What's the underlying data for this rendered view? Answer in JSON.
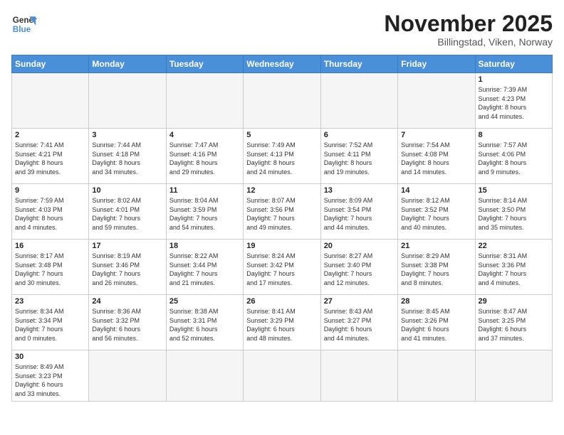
{
  "logo": {
    "line1": "General",
    "line2": "Blue"
  },
  "title": "November 2025",
  "location": "Billingstad, Viken, Norway",
  "weekdays": [
    "Sunday",
    "Monday",
    "Tuesday",
    "Wednesday",
    "Thursday",
    "Friday",
    "Saturday"
  ],
  "weeks": [
    [
      {
        "day": "",
        "info": ""
      },
      {
        "day": "",
        "info": ""
      },
      {
        "day": "",
        "info": ""
      },
      {
        "day": "",
        "info": ""
      },
      {
        "day": "",
        "info": ""
      },
      {
        "day": "",
        "info": ""
      },
      {
        "day": "1",
        "info": "Sunrise: 7:39 AM\nSunset: 4:23 PM\nDaylight: 8 hours\nand 44 minutes."
      }
    ],
    [
      {
        "day": "2",
        "info": "Sunrise: 7:41 AM\nSunset: 4:21 PM\nDaylight: 8 hours\nand 39 minutes."
      },
      {
        "day": "3",
        "info": "Sunrise: 7:44 AM\nSunset: 4:18 PM\nDaylight: 8 hours\nand 34 minutes."
      },
      {
        "day": "4",
        "info": "Sunrise: 7:47 AM\nSunset: 4:16 PM\nDaylight: 8 hours\nand 29 minutes."
      },
      {
        "day": "5",
        "info": "Sunrise: 7:49 AM\nSunset: 4:13 PM\nDaylight: 8 hours\nand 24 minutes."
      },
      {
        "day": "6",
        "info": "Sunrise: 7:52 AM\nSunset: 4:11 PM\nDaylight: 8 hours\nand 19 minutes."
      },
      {
        "day": "7",
        "info": "Sunrise: 7:54 AM\nSunset: 4:08 PM\nDaylight: 8 hours\nand 14 minutes."
      },
      {
        "day": "8",
        "info": "Sunrise: 7:57 AM\nSunset: 4:06 PM\nDaylight: 8 hours\nand 9 minutes."
      }
    ],
    [
      {
        "day": "9",
        "info": "Sunrise: 7:59 AM\nSunset: 4:03 PM\nDaylight: 8 hours\nand 4 minutes."
      },
      {
        "day": "10",
        "info": "Sunrise: 8:02 AM\nSunset: 4:01 PM\nDaylight: 7 hours\nand 59 minutes."
      },
      {
        "day": "11",
        "info": "Sunrise: 8:04 AM\nSunset: 3:59 PM\nDaylight: 7 hours\nand 54 minutes."
      },
      {
        "day": "12",
        "info": "Sunrise: 8:07 AM\nSunset: 3:56 PM\nDaylight: 7 hours\nand 49 minutes."
      },
      {
        "day": "13",
        "info": "Sunrise: 8:09 AM\nSunset: 3:54 PM\nDaylight: 7 hours\nand 44 minutes."
      },
      {
        "day": "14",
        "info": "Sunrise: 8:12 AM\nSunset: 3:52 PM\nDaylight: 7 hours\nand 40 minutes."
      },
      {
        "day": "15",
        "info": "Sunrise: 8:14 AM\nSunset: 3:50 PM\nDaylight: 7 hours\nand 35 minutes."
      }
    ],
    [
      {
        "day": "16",
        "info": "Sunrise: 8:17 AM\nSunset: 3:48 PM\nDaylight: 7 hours\nand 30 minutes."
      },
      {
        "day": "17",
        "info": "Sunrise: 8:19 AM\nSunset: 3:46 PM\nDaylight: 7 hours\nand 26 minutes."
      },
      {
        "day": "18",
        "info": "Sunrise: 8:22 AM\nSunset: 3:44 PM\nDaylight: 7 hours\nand 21 minutes."
      },
      {
        "day": "19",
        "info": "Sunrise: 8:24 AM\nSunset: 3:42 PM\nDaylight: 7 hours\nand 17 minutes."
      },
      {
        "day": "20",
        "info": "Sunrise: 8:27 AM\nSunset: 3:40 PM\nDaylight: 7 hours\nand 12 minutes."
      },
      {
        "day": "21",
        "info": "Sunrise: 8:29 AM\nSunset: 3:38 PM\nDaylight: 7 hours\nand 8 minutes."
      },
      {
        "day": "22",
        "info": "Sunrise: 8:31 AM\nSunset: 3:36 PM\nDaylight: 7 hours\nand 4 minutes."
      }
    ],
    [
      {
        "day": "23",
        "info": "Sunrise: 8:34 AM\nSunset: 3:34 PM\nDaylight: 7 hours\nand 0 minutes."
      },
      {
        "day": "24",
        "info": "Sunrise: 8:36 AM\nSunset: 3:32 PM\nDaylight: 6 hours\nand 56 minutes."
      },
      {
        "day": "25",
        "info": "Sunrise: 8:38 AM\nSunset: 3:31 PM\nDaylight: 6 hours\nand 52 minutes."
      },
      {
        "day": "26",
        "info": "Sunrise: 8:41 AM\nSunset: 3:29 PM\nDaylight: 6 hours\nand 48 minutes."
      },
      {
        "day": "27",
        "info": "Sunrise: 8:43 AM\nSunset: 3:27 PM\nDaylight: 6 hours\nand 44 minutes."
      },
      {
        "day": "28",
        "info": "Sunrise: 8:45 AM\nSunset: 3:26 PM\nDaylight: 6 hours\nand 41 minutes."
      },
      {
        "day": "29",
        "info": "Sunrise: 8:47 AM\nSunset: 3:25 PM\nDaylight: 6 hours\nand 37 minutes."
      }
    ],
    [
      {
        "day": "30",
        "info": "Sunrise: 8:49 AM\nSunset: 3:23 PM\nDaylight: 6 hours\nand 33 minutes."
      },
      {
        "day": "",
        "info": ""
      },
      {
        "day": "",
        "info": ""
      },
      {
        "day": "",
        "info": ""
      },
      {
        "day": "",
        "info": ""
      },
      {
        "day": "",
        "info": ""
      },
      {
        "day": "",
        "info": ""
      }
    ]
  ]
}
